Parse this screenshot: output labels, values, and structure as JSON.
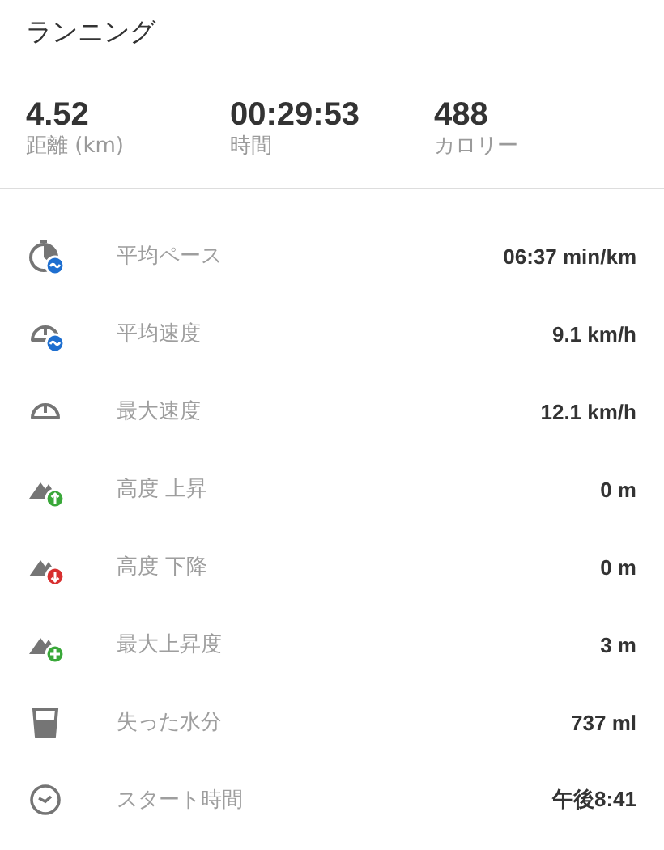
{
  "title": "ランニング",
  "summary": [
    {
      "value": "4.52",
      "label": "距離 (km)"
    },
    {
      "value": "00:29:53",
      "label": "時間"
    },
    {
      "value": "488",
      "label": "カロリー"
    }
  ],
  "metrics": [
    {
      "kind": "pace",
      "label": "平均ペース",
      "value": "06:37 min/km"
    },
    {
      "kind": "speed",
      "label": "平均速度",
      "value": "9.1 km/h"
    },
    {
      "kind": "maxspeed",
      "label": "最大速度",
      "value": "12.1 km/h"
    },
    {
      "kind": "ascent",
      "label": "高度 上昇",
      "value": "0 m"
    },
    {
      "kind": "descent",
      "label": "高度 下降",
      "value": "0 m"
    },
    {
      "kind": "maxascent",
      "label": "最大上昇度",
      "value": "3 m"
    },
    {
      "kind": "water",
      "label": "失った水分",
      "value": "737 ml"
    },
    {
      "kind": "clock",
      "label": "スタート時間",
      "value": "午後8:41"
    }
  ]
}
